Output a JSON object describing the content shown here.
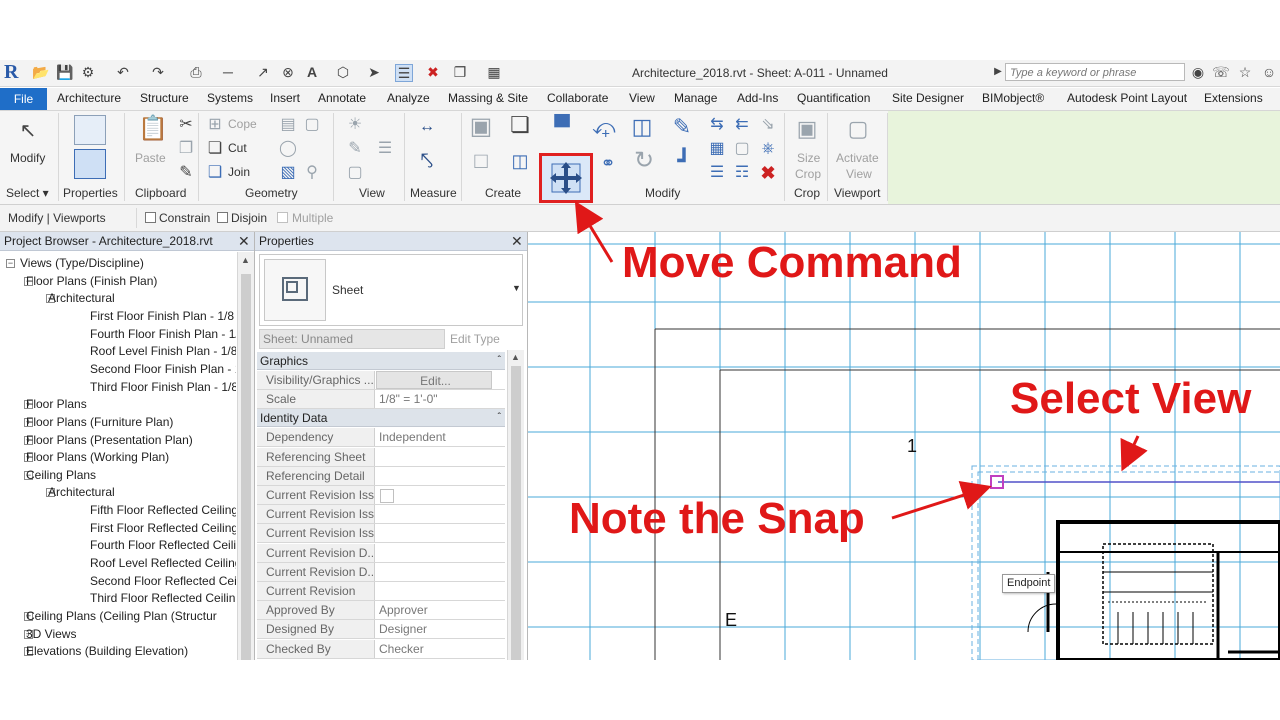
{
  "app": {
    "title": "Architecture_2018.rvt - Sheet: A-011 - Unnamed",
    "search_placeholder": "Type a keyword or phrase",
    "logo": "R"
  },
  "tabs": [
    "File",
    "Architecture",
    "Structure",
    "Systems",
    "Insert",
    "Annotate",
    "Analyze",
    "Massing & Site",
    "Collaborate",
    "View",
    "Manage",
    "Add-Ins",
    "Quantification",
    "Site Designer",
    "BIMobject®",
    "Autodesk Point Layout",
    "Extensions"
  ],
  "ribbon": {
    "modify_label": "Modify",
    "paste_label": "Paste",
    "cope_label": "Cope",
    "cut_label": "Cut",
    "join_label": "Join",
    "size_crop_label1": "Size",
    "size_crop_label2": "Crop",
    "activate_view_label1": "Activate",
    "activate_view_label2": "View",
    "panels": [
      "Select ▾",
      "Properties",
      "Clipboard",
      "Geometry",
      "View",
      "Measure",
      "Create",
      "Modify",
      "Crop",
      "Viewport"
    ]
  },
  "options_bar": {
    "context": "Modify | Viewports",
    "constrain": "Constrain",
    "disjoin": "Disjoin",
    "multiple": "Multiple"
  },
  "project_browser": {
    "title": "Project Browser - Architecture_2018.rvt",
    "items": [
      {
        "label": "Views (Type/Discipline)",
        "level": 0,
        "expander": "−"
      },
      {
        "label": "Floor Plans (Finish Plan)",
        "level": 1,
        "expander": "−"
      },
      {
        "label": "Architectural",
        "level": 2,
        "expander": "−"
      },
      {
        "label": "First Floor Finish Plan - 1/8",
        "level": 3,
        "expander": ""
      },
      {
        "label": "Fourth Floor Finish Plan - 1/",
        "level": 3,
        "expander": ""
      },
      {
        "label": "Roof Level Finish Plan - 1/8",
        "level": 3,
        "expander": ""
      },
      {
        "label": "Second Floor Finish Plan - 1",
        "level": 3,
        "expander": ""
      },
      {
        "label": "Third Floor Finish Plan - 1/8",
        "level": 3,
        "expander": ""
      },
      {
        "label": "Floor Plans",
        "level": 1,
        "expander": "+"
      },
      {
        "label": "Floor Plans (Furniture Plan)",
        "level": 1,
        "expander": "+"
      },
      {
        "label": "Floor Plans (Presentation Plan)",
        "level": 1,
        "expander": "+"
      },
      {
        "label": "Floor Plans (Working Plan)",
        "level": 1,
        "expander": "+"
      },
      {
        "label": "Ceiling Plans",
        "level": 1,
        "expander": "−"
      },
      {
        "label": "Architectural",
        "level": 2,
        "expander": "−"
      },
      {
        "label": "Fifth Floor Reflected Ceiling",
        "level": 3,
        "expander": ""
      },
      {
        "label": "First Floor Reflected Ceiling",
        "level": 3,
        "expander": ""
      },
      {
        "label": "Fourth Floor Reflected Ceili",
        "level": 3,
        "expander": ""
      },
      {
        "label": "Roof Level Reflected Ceiling",
        "level": 3,
        "expander": ""
      },
      {
        "label": "Second Floor Reflected Ceil",
        "level": 3,
        "expander": ""
      },
      {
        "label": "Third Floor Reflected Ceilin",
        "level": 3,
        "expander": ""
      },
      {
        "label": "Ceiling Plans (Ceiling Plan (Structur",
        "level": 1,
        "expander": "+"
      },
      {
        "label": "3D Views",
        "level": 1,
        "expander": "+"
      },
      {
        "label": "Elevations (Building Elevation)",
        "level": 1,
        "expander": "+"
      }
    ]
  },
  "properties": {
    "title": "Properties",
    "type_name": "Sheet",
    "selector": "Sheet: Unnamed",
    "edit_type": "Edit Type",
    "sections": [
      {
        "name": "Graphics",
        "rows": [
          {
            "key": "Visibility/Graphics ...",
            "value": "Edit...",
            "button": true
          },
          {
            "key": "Scale",
            "value": "1/8\" = 1'-0\""
          }
        ]
      },
      {
        "name": "Identity Data",
        "rows": [
          {
            "key": "Dependency",
            "value": "Independent"
          },
          {
            "key": "Referencing Sheet",
            "value": ""
          },
          {
            "key": "Referencing Detail",
            "value": ""
          },
          {
            "key": "Current Revision Iss...",
            "value": "",
            "checkbox": true
          },
          {
            "key": "Current Revision Iss...",
            "value": ""
          },
          {
            "key": "Current Revision Iss...",
            "value": ""
          },
          {
            "key": "Current Revision D...",
            "value": ""
          },
          {
            "key": "Current Revision D...",
            "value": ""
          },
          {
            "key": "Current Revision",
            "value": ""
          },
          {
            "key": "Approved By",
            "value": "Approver"
          },
          {
            "key": "Designed By",
            "value": "Designer"
          },
          {
            "key": "Checked By",
            "value": "Checker"
          }
        ]
      }
    ]
  },
  "canvas": {
    "grid_label_1": "1",
    "grid_label_e": "E",
    "snap_tooltip": "Endpoint"
  },
  "annotations": {
    "move_command": "Move Command",
    "select_view": "Select View",
    "note_snap": "Note the Snap"
  },
  "colors": {
    "annotation": "#e01818",
    "grid": "#4aa8d8",
    "file_tab": "#1f6ec8",
    "snap": "#c040c0"
  }
}
